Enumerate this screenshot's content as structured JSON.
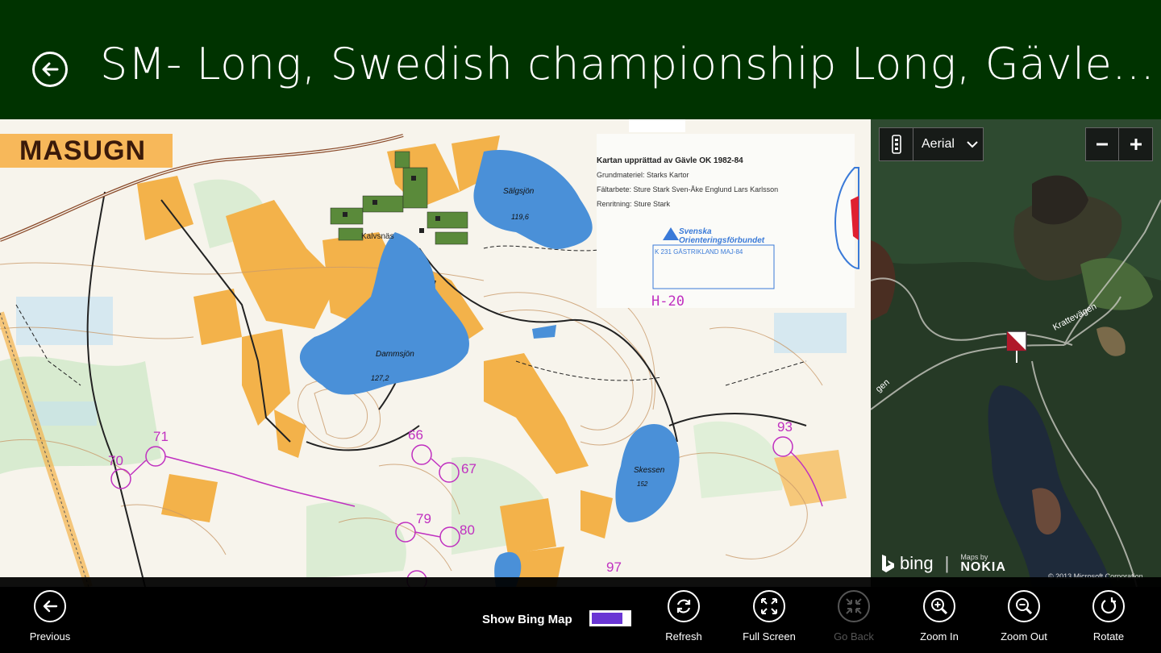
{
  "header": {
    "title": "SM- Long, Swedish championship Long, Gävle..."
  },
  "orienteering_map": {
    "place_name": "MASUGN",
    "info_line1": "Kartan upprättad av Gävle OK 1982-84",
    "info_line2": "Grundmateriel: Starks Kartor",
    "info_line3": "Fältarbete: Sture Stark    Sven-Åke Englund    Lars Karlsson",
    "info_line4": "Renritning: Sture Stark",
    "federation": "Svenska Orienteringsförbundet",
    "permit": "K 231 GÄSTRIKLAND MAJ-84",
    "class_code": "H-20",
    "lakes": [
      {
        "name": "Sälgsjön",
        "elev": "119,6"
      },
      {
        "name": "Dammsjön",
        "elev": "127,2"
      },
      {
        "name": "Skessen",
        "elev": "152"
      }
    ],
    "village": "Kalvsnäs",
    "controls": [
      "71",
      "70",
      "66",
      "67",
      "79",
      "80",
      "93",
      "97"
    ]
  },
  "bing_map": {
    "style_label": "Aerial",
    "road_label": "Krattevägen",
    "road_label2": "gen",
    "bing_text": "bing",
    "maps_by": "Maps by",
    "nokia": "NOKIA",
    "copyright": "© 2013 Microsoft Corporation"
  },
  "appbar": {
    "previous": "Previous",
    "show_bing_map": "Show Bing Map",
    "refresh": "Refresh",
    "full_screen": "Full Screen",
    "go_back": "Go Back",
    "zoom_in": "Zoom In",
    "zoom_out": "Zoom Out",
    "rotate": "Rotate"
  },
  "colors": {
    "header_bg": "#003300",
    "toggle_accent": "#6a36d4",
    "control_magenta": "#c030c0",
    "lake_blue": "#4a90d8",
    "field_orange": "#f3b24a"
  }
}
